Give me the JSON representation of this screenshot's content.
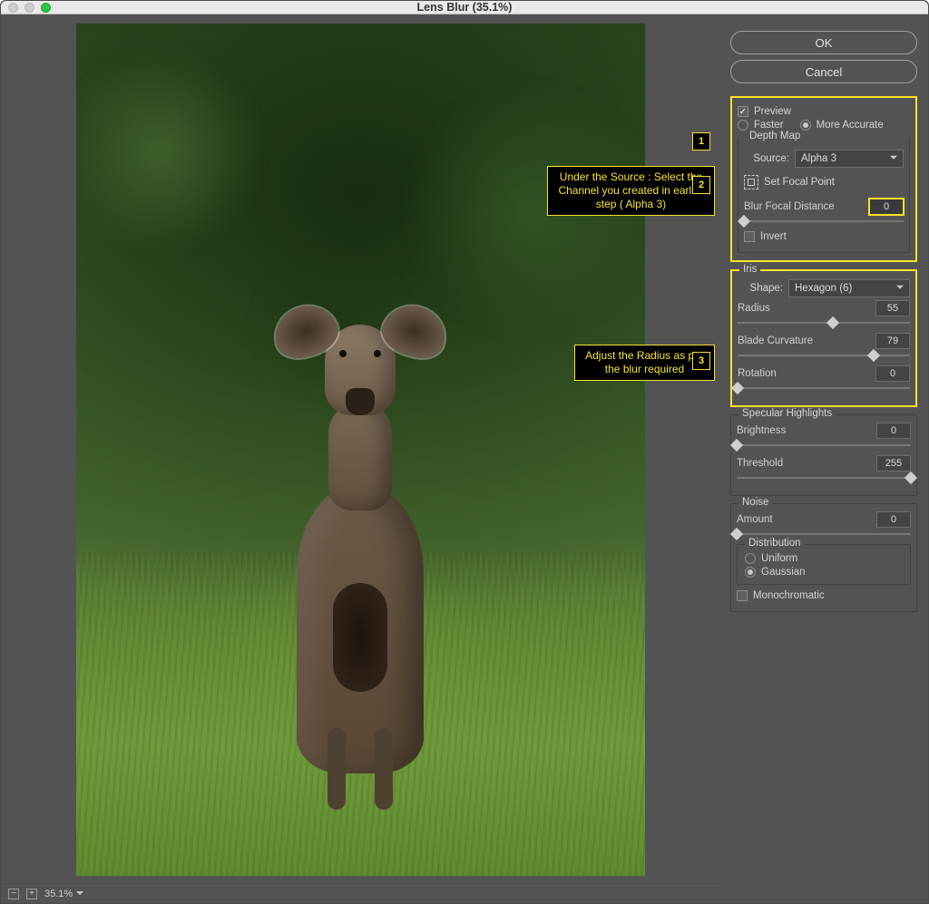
{
  "window": {
    "title": "Lens Blur (35.1%)"
  },
  "statusbar": {
    "zoom": "35.1%"
  },
  "annotations": {
    "n1": "1",
    "n2": "2",
    "n3": "3",
    "source_hint": "Under the Source : Select the Channel you created in earlier step ( Alpha 3)",
    "radius_hint": "Adjust the Radius as per the blur required"
  },
  "buttons": {
    "ok": "OK",
    "cancel": "Cancel"
  },
  "preview": {
    "checkbox_label": "Preview",
    "checked": true,
    "faster": "Faster",
    "more_accurate": "More Accurate",
    "mode": "more_accurate"
  },
  "depth_map": {
    "title": "Depth Map",
    "source_label": "Source:",
    "source_value": "Alpha 3",
    "set_focal": "Set Focal Point",
    "bfd_label": "Blur Focal Distance",
    "bfd_value": "0",
    "invert": "Invert",
    "invert_checked": false
  },
  "iris": {
    "title": "Iris",
    "shape_label": "Shape:",
    "shape_value": "Hexagon (6)",
    "radius_label": "Radius",
    "radius_value": "55",
    "blade_label": "Blade Curvature",
    "blade_value": "79",
    "rotation_label": "Rotation",
    "rotation_value": "0"
  },
  "specular": {
    "title": "Specular Highlights",
    "brightness_label": "Brightness",
    "brightness_value": "0",
    "threshold_label": "Threshold",
    "threshold_value": "255"
  },
  "noise": {
    "title": "Noise",
    "amount_label": "Amount",
    "amount_value": "0",
    "dist_title": "Distribution",
    "uniform": "Uniform",
    "gaussian": "Gaussian",
    "mono": "Monochromatic"
  }
}
